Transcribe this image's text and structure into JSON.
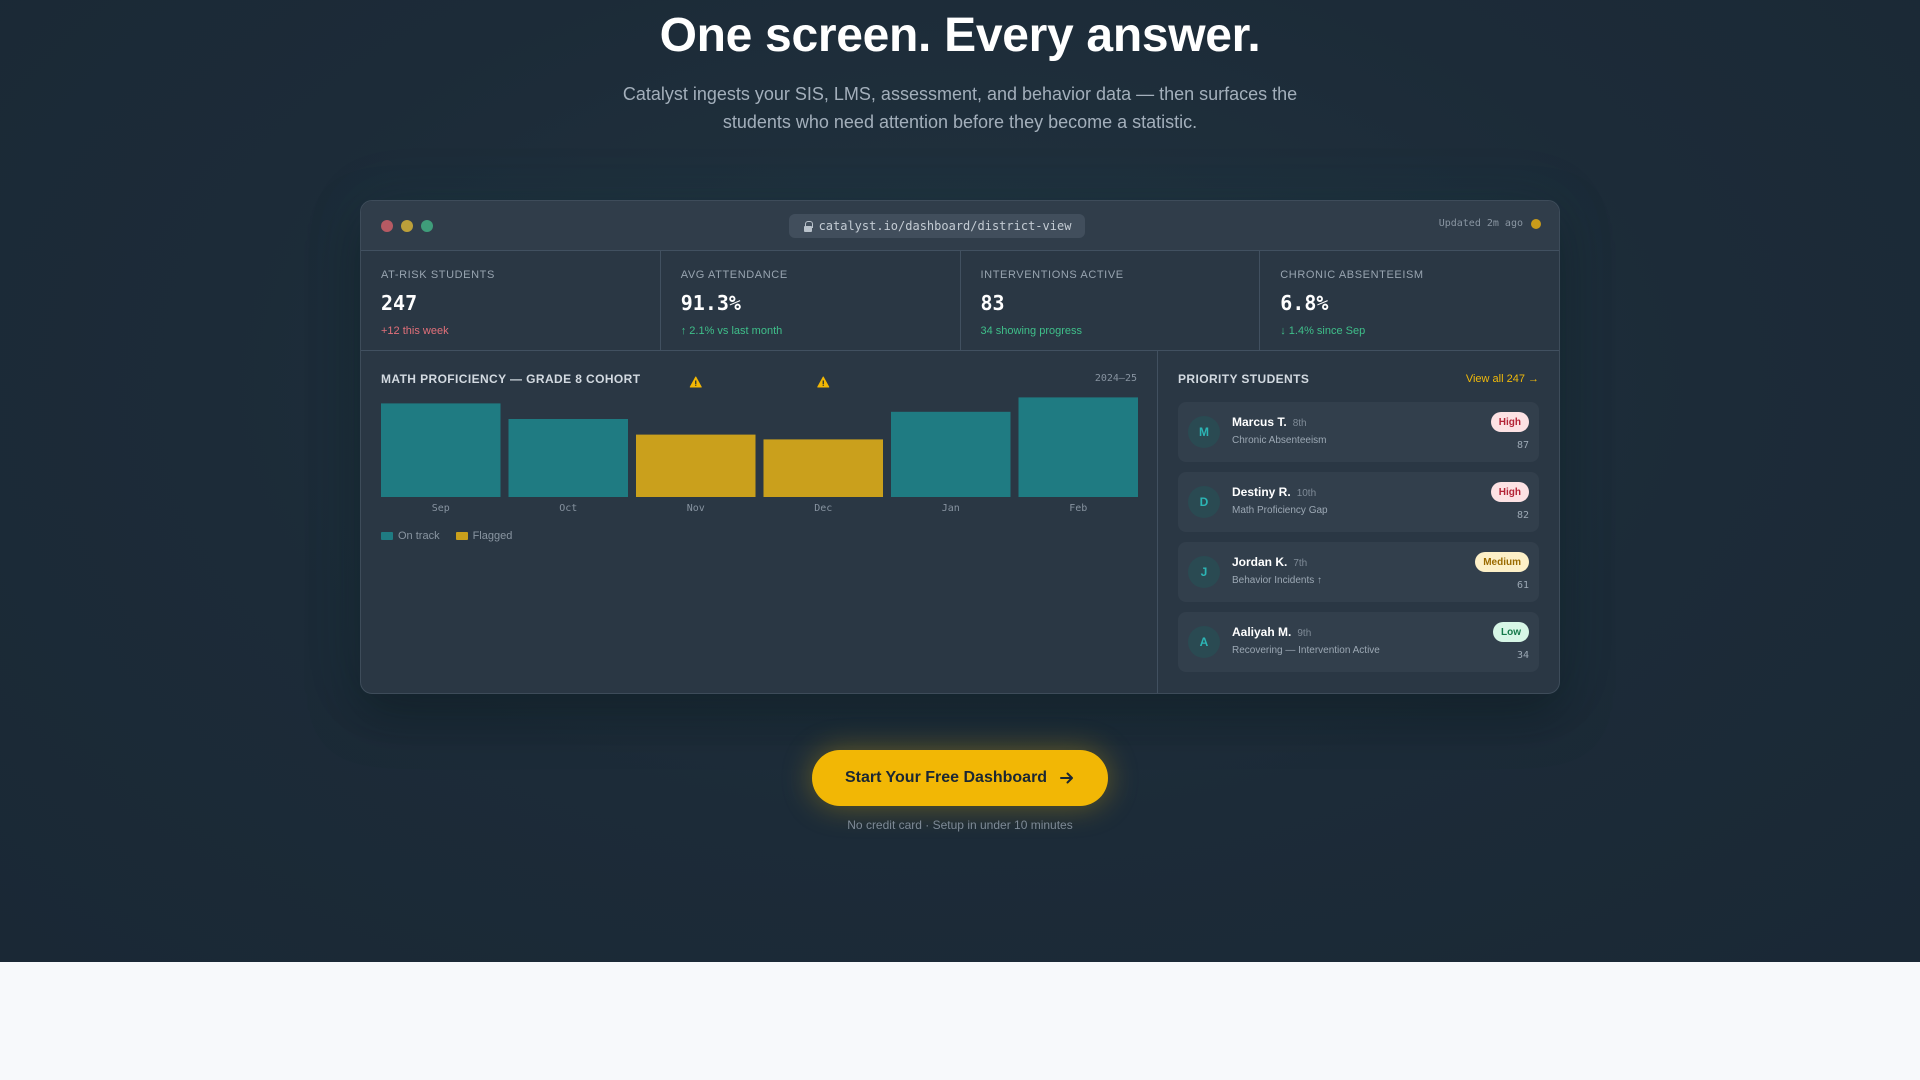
{
  "hero": {
    "headline": "One screen. Every answer.",
    "subhead": "Catalyst ingests your SIS, LMS, assessment, and behavior data — then surfaces the students who need attention before they become a statistic."
  },
  "window": {
    "url": "catalyst.io/dashboard/district-view",
    "updated": "Updated 2m ago"
  },
  "stats": [
    {
      "label": "AT-RISK STUDENTS",
      "value": "247",
      "delta": "+12 this week"
    },
    {
      "label": "AVG ATTENDANCE",
      "value": "91.3%",
      "delta": "↑ 2.1% vs last month"
    },
    {
      "label": "INTERVENTIONS ACTIVE",
      "value": "83",
      "delta": "34 showing progress"
    },
    {
      "label": "CHRONIC ABSENTEEISM",
      "value": "6.8%",
      "delta": "↓ 1.4% since Sep"
    }
  ],
  "chart": {
    "title": "MATH PROFICIENCY — GRADE 8 COHORT",
    "year": "2024–25",
    "legend": {
      "on_track": "On track",
      "flagged": "Flagged"
    }
  },
  "chart_data": {
    "type": "bar",
    "title": "MATH PROFICIENCY — GRADE 8 COHORT",
    "categories": [
      "Sep",
      "Oct",
      "Nov",
      "Dec",
      "Jan",
      "Feb"
    ],
    "values": [
      78,
      65,
      52,
      48,
      71,
      83
    ],
    "status": [
      "On track",
      "On track",
      "Flagged",
      "Flagged",
      "On track",
      "On track"
    ],
    "flag_markers": [
      "Nov",
      "Dec"
    ],
    "colors": {
      "On track": "#1f7b82",
      "Flagged": "#caa01c"
    },
    "ylim": [
      0,
      100
    ],
    "grid": false,
    "legend_position": "bottom-left"
  },
  "priority": {
    "title": "PRIORITY STUDENTS",
    "view_all": "View all 247 →",
    "students": [
      {
        "initial": "M",
        "name": "Marcus T.",
        "grade": "8th",
        "reason": "Chronic Absenteeism",
        "level": "High",
        "score": "87"
      },
      {
        "initial": "D",
        "name": "Destiny R.",
        "grade": "10th",
        "reason": "Math Proficiency Gap",
        "level": "High",
        "score": "82"
      },
      {
        "initial": "J",
        "name": "Jordan K.",
        "grade": "7th",
        "reason": "Behavior Incidents ↑",
        "level": "Medium",
        "score": "61"
      },
      {
        "initial": "A",
        "name": "Aaliyah M.",
        "grade": "9th",
        "reason": "Recovering — Intervention Active",
        "level": "Low",
        "score": "34"
      }
    ]
  },
  "cta": {
    "label": "Start Your Free Dashboard",
    "note": "No credit card · Setup in under 10 minutes"
  }
}
